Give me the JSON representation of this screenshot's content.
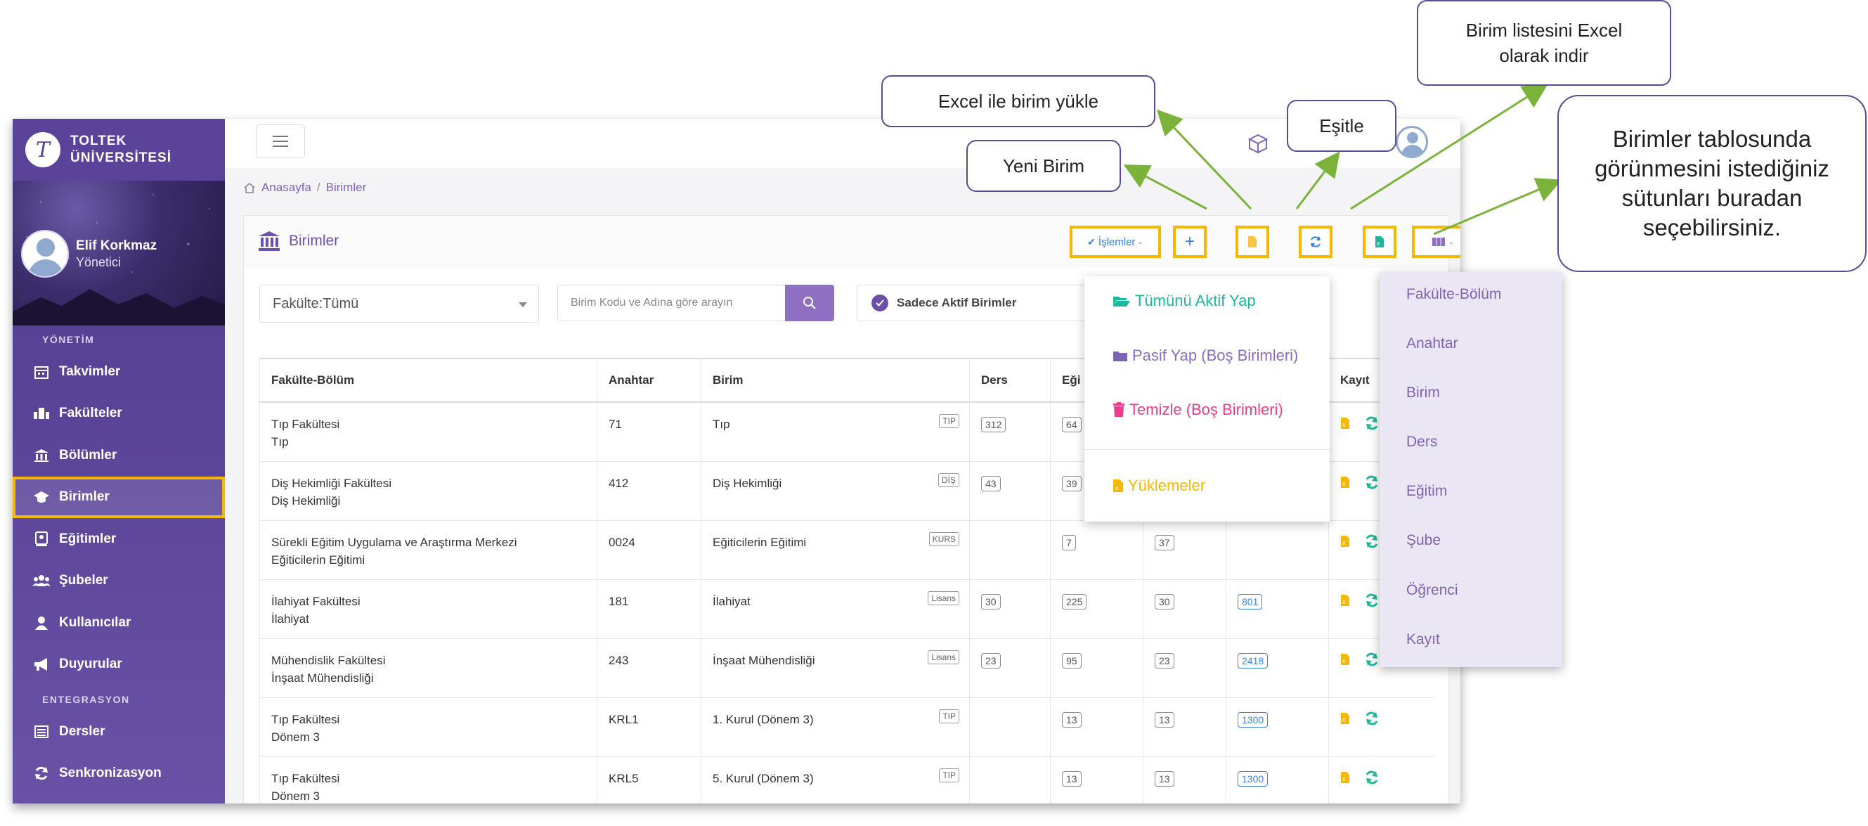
{
  "brand": {
    "line1": "TOLTEK",
    "line2": "ÜNİVERSİTESİ",
    "logo_letter": "T"
  },
  "profile": {
    "name": "Elif Korkmaz",
    "role": "Yönetici"
  },
  "sidebar": {
    "section1": "YÖNETİM",
    "items1": [
      {
        "label": "Takvimler",
        "icon": "calendar-icon"
      },
      {
        "label": "Fakülteler",
        "icon": "faculty-icon"
      },
      {
        "label": "Bölümler",
        "icon": "building-icon"
      },
      {
        "label": "Birimler",
        "icon": "graduation-cap-icon",
        "active": true
      },
      {
        "label": "Eğitimler",
        "icon": "certificate-icon"
      },
      {
        "label": "Şubeler",
        "icon": "users-icon"
      },
      {
        "label": "Kullanıcılar",
        "icon": "user-icon"
      },
      {
        "label": "Duyurular",
        "icon": "megaphone-icon"
      }
    ],
    "section2": "ENTEGRASYON",
    "items2": [
      {
        "label": "Dersler",
        "icon": "list-icon"
      },
      {
        "label": "Senkronizasyon",
        "icon": "sync-icon"
      }
    ]
  },
  "breadcrumb": {
    "home": "Anasayfa",
    "separator": "/",
    "current": "Birimler"
  },
  "card": {
    "title": "Birimler"
  },
  "toolbar": {
    "actions_label": "İşlemler",
    "add_symbol": "+"
  },
  "filters": {
    "faculty_select": "Fakülte:Tümü",
    "search_placeholder": "Birim Kodu ve Adına göre arayın",
    "active_only_label": "Sadece Aktif Birimler"
  },
  "table": {
    "headers": [
      "Fakülte-Bölüm",
      "Anahtar",
      "Birim",
      "Ders",
      "Eği",
      "",
      "",
      "Kayıt"
    ],
    "rows": [
      {
        "fac": "Tıp Fakültesi",
        "dept": "Tıp",
        "key": "71",
        "unit": "Tıp",
        "tag": "TIP",
        "ders": "312",
        "egitim": "64",
        "sube": "",
        "ogrenci": ""
      },
      {
        "fac": "Diş Hekimliği Fakültesi",
        "dept": "Diş Hekimliği",
        "key": "412",
        "unit": "Diş Hekimliği",
        "tag": "DİŞ",
        "ders": "43",
        "egitim": "39",
        "sube": "",
        "ogrenci": ""
      },
      {
        "fac": "Sürekli Eğitim Uygulama ve Araştırma Merkezi",
        "dept": "Eğiticilerin Eğitimi",
        "key": "0024",
        "unit": "Eğiticilerin Eğitimi",
        "tag": "KURS",
        "ders": "",
        "egitim": "7",
        "sube": "37",
        "ogrenci": ""
      },
      {
        "fac": "İlahiyat Fakültesi",
        "dept": "İlahiyat",
        "key": "181",
        "unit": "İlahiyat",
        "tag": "Lisans",
        "ders": "30",
        "egitim": "225",
        "sube": "30",
        "ogrenci": "801"
      },
      {
        "fac": "Mühendislik Fakültesi",
        "dept": "İnşaat Mühendisliği",
        "key": "243",
        "unit": "İnşaat Mühendisliği",
        "tag": "Lisans",
        "ders": "23",
        "egitim": "95",
        "sube": "23",
        "ogrenci": "2418"
      },
      {
        "fac": "Tıp Fakültesi",
        "dept": "Dönem 3",
        "key": "KRL1",
        "unit": "1. Kurul (Dönem 3)",
        "tag": "TIP",
        "ders": "",
        "egitim": "13",
        "sube": "13",
        "ogrenci": "1300"
      },
      {
        "fac": "Tıp Fakültesi",
        "dept": "Dönem 3",
        "key": "KRL5",
        "unit": "5. Kurul (Dönem 3)",
        "tag": "TIP",
        "ders": "",
        "egitim": "13",
        "sube": "13",
        "ogrenci": "1300"
      }
    ]
  },
  "actions_menu": {
    "activate_all": "Tümünü Aktif Yap",
    "deactivate": "Pasif Yap (Boş Birimleri)",
    "clean": "Temizle (Boş Birimleri)",
    "uploads": "Yüklemeler"
  },
  "column_menu": [
    "Fakülte-Bölüm",
    "Anahtar",
    "Birim",
    "Ders",
    "Eğitim",
    "Şube",
    "Öğrenci",
    "Kayıt"
  ],
  "callouts": {
    "new_unit": "Yeni Birim",
    "excel_upload": "Excel ile birim yükle",
    "sync": "Eşitle",
    "excel_download": "Birim listesini Excel olarak indir",
    "columns": "Birimler tablosunda görünmesini istediğiniz sütunları buradan seçebilirsiniz."
  },
  "colors": {
    "sidebar": "#5b4399",
    "accent": "#7d64b5",
    "highlight": "#f5b800",
    "arrow": "#7bb33a",
    "teal": "#1bb99a",
    "pink": "#e83e8c",
    "excel": "#f5b800"
  }
}
